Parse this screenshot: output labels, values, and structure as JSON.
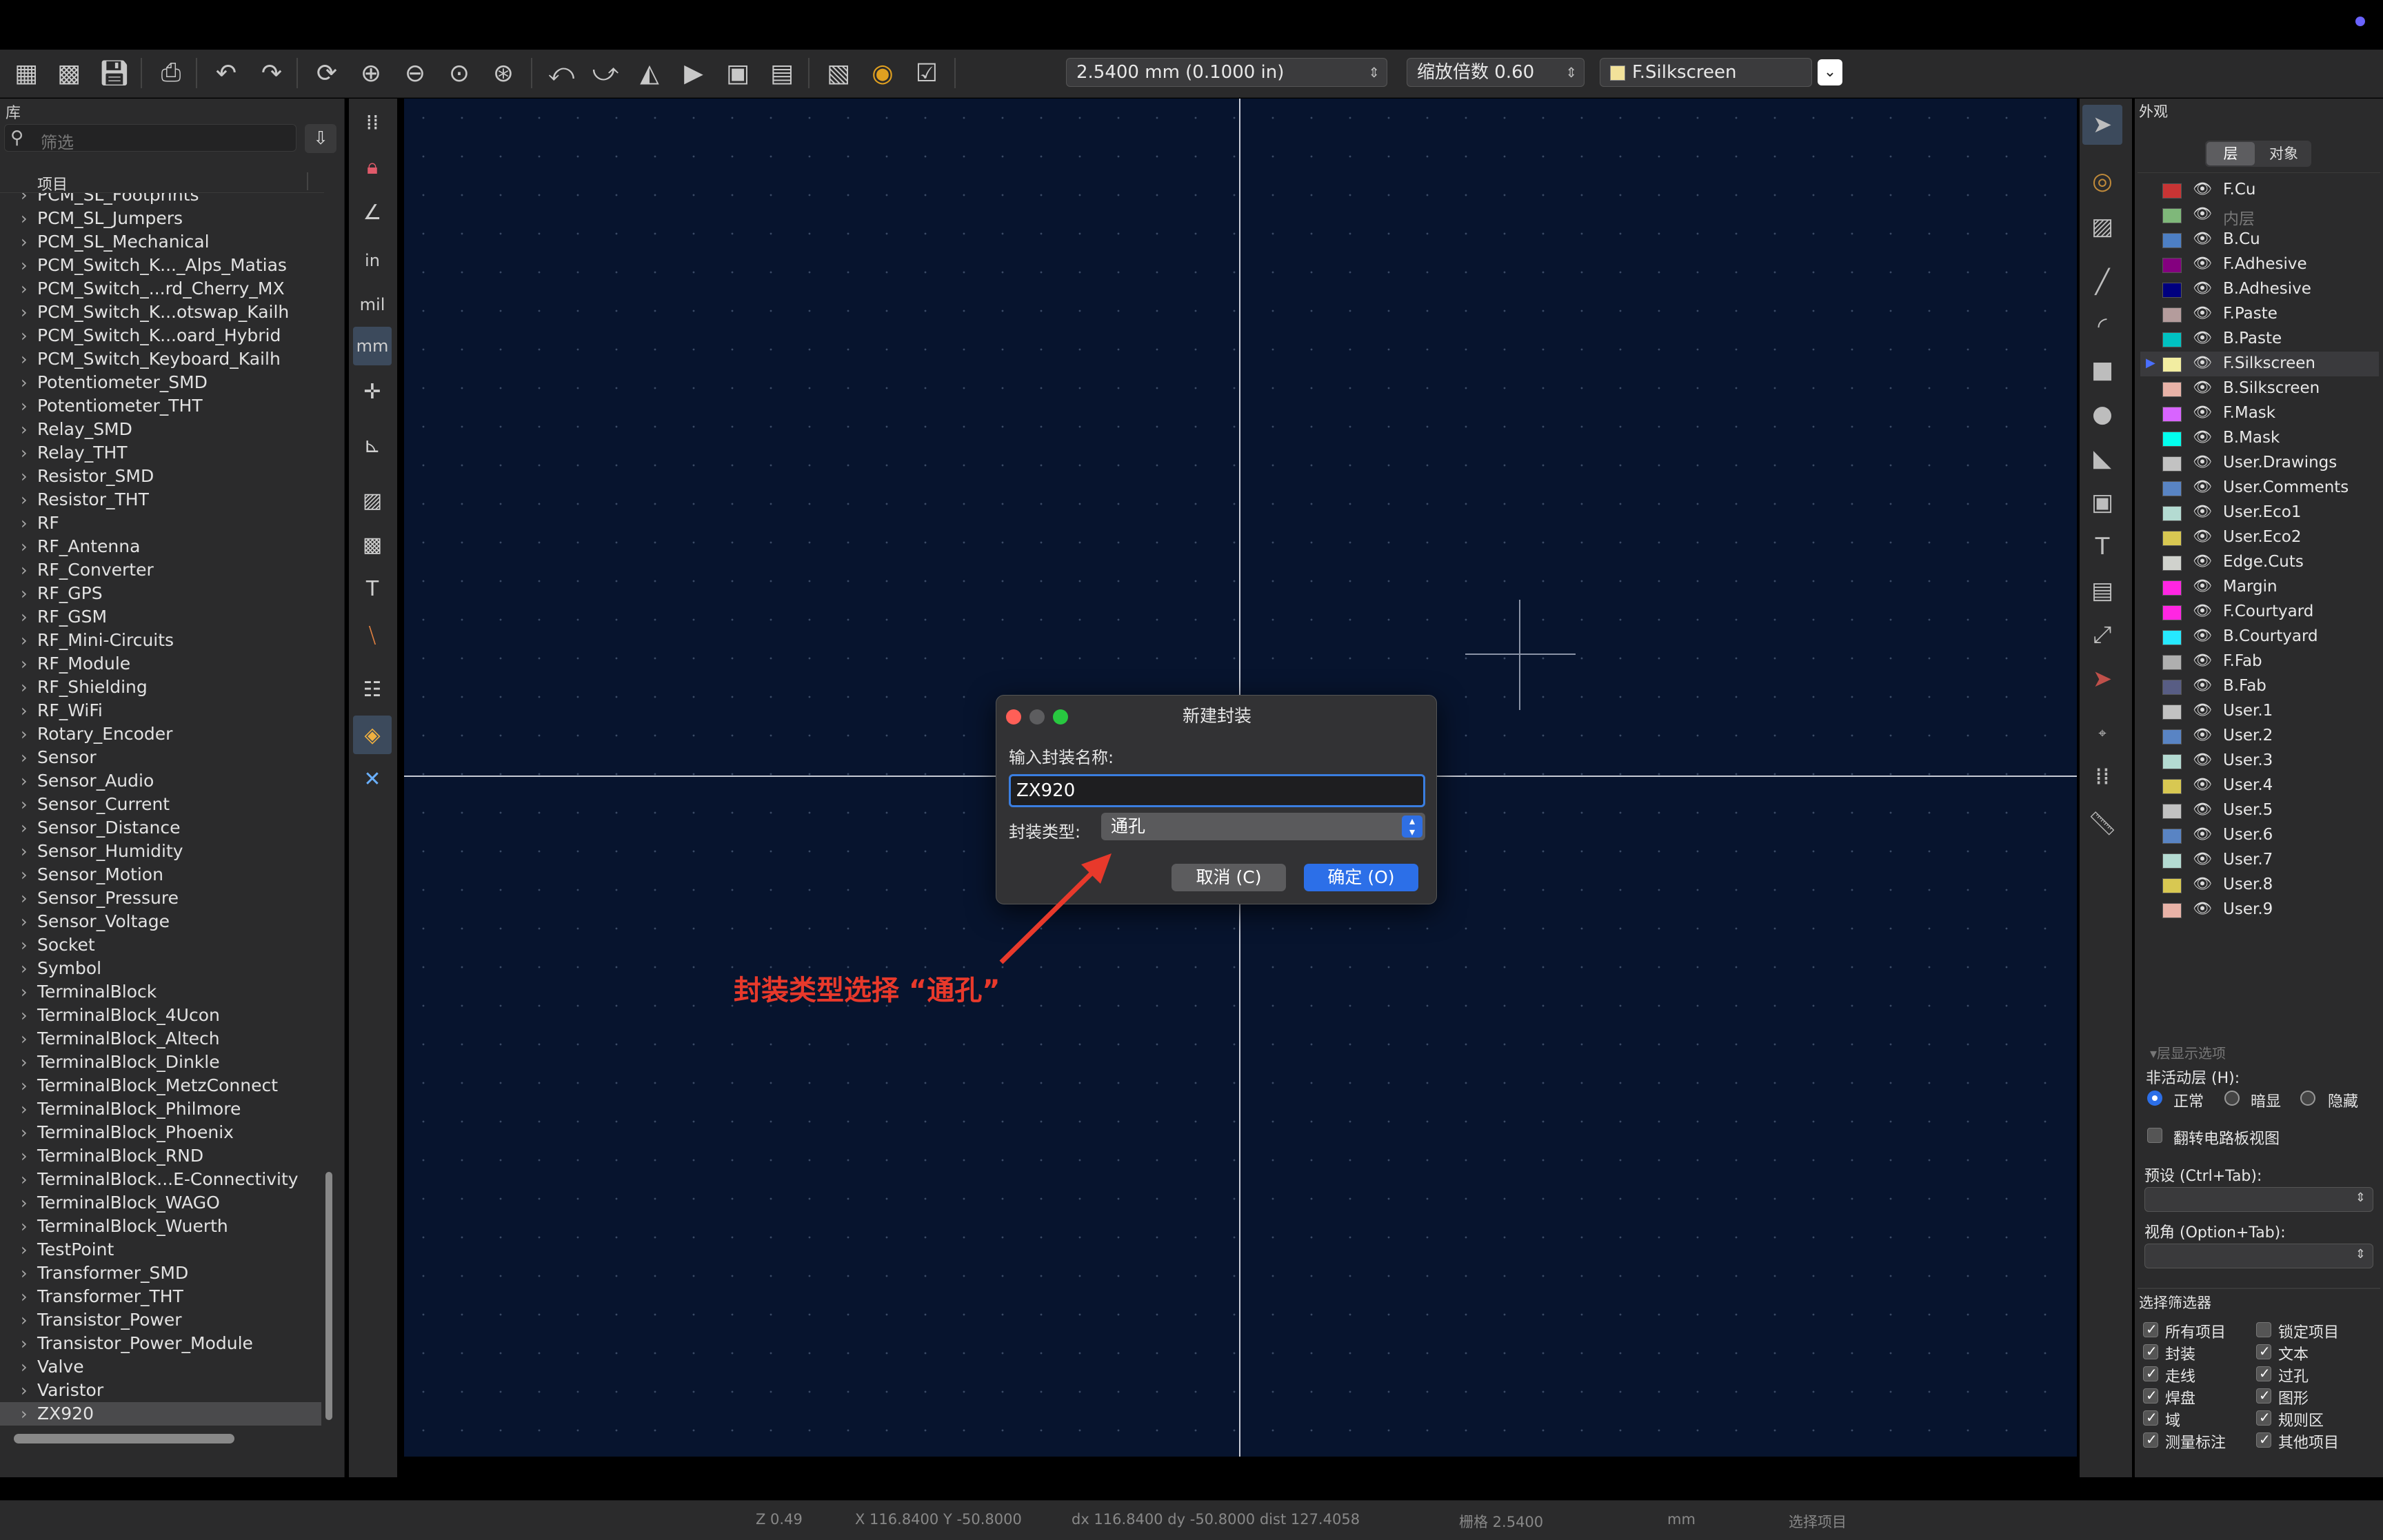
{
  "toolbar": {
    "grid_select": "2.5400 mm (0.1000 in)",
    "zoom_select": "缩放倍数 0.60",
    "layer_select": "F.Silkscreen",
    "icons": [
      "new-footprint-icon",
      "new-from-wizard-icon",
      "save-icon",
      "print-icon",
      "undo-icon",
      "redo-icon",
      "refresh-icon",
      "zoom-in-icon",
      "zoom-out-icon",
      "zoom-fit-icon",
      "zoom-selection-icon",
      "rotate-ccw-icon",
      "rotate-cw-icon",
      "mirror-h-icon",
      "mirror-v-icon",
      "group-icon",
      "ungroup-icon",
      "footprint-properties-icon",
      "pad-properties-icon",
      "check-footprint-icon"
    ]
  },
  "library": {
    "title": "库",
    "filter_placeholder": "筛选",
    "column_header": "项目",
    "items": [
      "PCM_SL_Footprints",
      "PCM_SL_Jumpers",
      "PCM_SL_Mechanical",
      "PCM_Switch_K..._Alps_Matias",
      "PCM_Switch_...rd_Cherry_MX",
      "PCM_Switch_K...otswap_Kailh",
      "PCM_Switch_K...oard_Hybrid",
      "PCM_Switch_Keyboard_Kailh",
      "Potentiometer_SMD",
      "Potentiometer_THT",
      "Relay_SMD",
      "Relay_THT",
      "Resistor_SMD",
      "Resistor_THT",
      "RF",
      "RF_Antenna",
      "RF_Converter",
      "RF_GPS",
      "RF_GSM",
      "RF_Mini-Circuits",
      "RF_Module",
      "RF_Shielding",
      "RF_WiFi",
      "Rotary_Encoder",
      "Sensor",
      "Sensor_Audio",
      "Sensor_Current",
      "Sensor_Distance",
      "Sensor_Humidity",
      "Sensor_Motion",
      "Sensor_Pressure",
      "Sensor_Voltage",
      "Socket",
      "Symbol",
      "TerminalBlock",
      "TerminalBlock_4Ucon",
      "TerminalBlock_Altech",
      "TerminalBlock_Dinkle",
      "TerminalBlock_MetzConnect",
      "TerminalBlock_Philmore",
      "TerminalBlock_Phoenix",
      "TerminalBlock_RND",
      "TerminalBlock...E-Connectivity",
      "TerminalBlock_WAGO",
      "TerminalBlock_Wuerth",
      "TestPoint",
      "Transformer_SMD",
      "Transformer_THT",
      "Transistor_Power",
      "Transistor_Power_Module",
      "Valve",
      "Varistor",
      "ZX920"
    ],
    "selected": "ZX920"
  },
  "dialog": {
    "title": "新建封装",
    "name_label": "输入封装名称:",
    "name_value": "ZX920",
    "type_label": "封装类型:",
    "type_value": "通孔",
    "cancel": "取消 (C)",
    "ok": "确定 (O)"
  },
  "annotation": "封装类型选择 “通孔”",
  "appearance": {
    "title": "外观",
    "tab_layers": "层",
    "tab_objects": "对象",
    "active_layer": "F.Silkscreen",
    "layers": [
      {
        "name": "F.Cu",
        "color": "#c83434"
      },
      {
        "name": "内层",
        "color": "#7fb87a",
        "dim": true
      },
      {
        "name": "B.Cu",
        "color": "#4d7fc4"
      },
      {
        "name": "F.Adhesive",
        "color": "#84007f"
      },
      {
        "name": "B.Adhesive",
        "color": "#00007f"
      },
      {
        "name": "F.Paste",
        "color": "#b49c9c"
      },
      {
        "name": "B.Paste",
        "color": "#00c2c2"
      },
      {
        "name": "F.Silkscreen",
        "color": "#f2eda1"
      },
      {
        "name": "B.Silkscreen",
        "color": "#e8b2a7"
      },
      {
        "name": "F.Mask",
        "color": "#d864ff"
      },
      {
        "name": "B.Mask",
        "color": "#02ffee"
      },
      {
        "name": "User.Drawings",
        "color": "#c2c2c2"
      },
      {
        "name": "User.Comments",
        "color": "#5984c4"
      },
      {
        "name": "User.Eco1",
        "color": "#b4dbd2"
      },
      {
        "name": "User.Eco2",
        "color": "#d8c852"
      },
      {
        "name": "Edge.Cuts",
        "color": "#d0d2cd"
      },
      {
        "name": "Margin",
        "color": "#ff26e2"
      },
      {
        "name": "F.Courtyard",
        "color": "#ff26e2"
      },
      {
        "name": "B.Courtyard",
        "color": "#26e9ff"
      },
      {
        "name": "F.Fab",
        "color": "#afafaf"
      },
      {
        "name": "B.Fab",
        "color": "#585d84"
      },
      {
        "name": "User.1",
        "color": "#c2c2c2"
      },
      {
        "name": "User.2",
        "color": "#5984c4"
      },
      {
        "name": "User.3",
        "color": "#b4dbd2"
      },
      {
        "name": "User.4",
        "color": "#d8c852"
      },
      {
        "name": "User.5",
        "color": "#c2c2c2"
      },
      {
        "name": "User.6",
        "color": "#5984c4"
      },
      {
        "name": "User.7",
        "color": "#b4dbd2"
      },
      {
        "name": "User.8",
        "color": "#d8c852"
      },
      {
        "name": "User.9",
        "color": "#e8b2a7"
      }
    ],
    "layer_display_options": "层显示选项",
    "inactive_layers_label": "非活动层 (H):",
    "inactive_normal": "正常",
    "inactive_dim": "暗显",
    "inactive_hide": "隐藏",
    "flip_board": "翻转电路板视图",
    "presets_label": "预设 (Ctrl+Tab):",
    "viewport_label": "视角 (Option+Tab):"
  },
  "selection_filter": {
    "title": "选择筛选器",
    "left": [
      "所有项目",
      "封装",
      "走线",
      "焊盘",
      "域",
      "测量标注"
    ],
    "right": [
      "锁定项目",
      "文本",
      "过孔",
      "图形",
      "规则区",
      "其他项目"
    ],
    "right_checked": [
      false,
      true,
      true,
      true,
      true,
      true
    ]
  },
  "status": {
    "z": "Z 0.49",
    "xy": "X 116.8400  Y -50.8000",
    "dxy": "dx 116.8400  dy -50.8000  dist 127.4058",
    "grid": "栅格 2.5400",
    "units": "mm",
    "mode": "选择项目"
  }
}
